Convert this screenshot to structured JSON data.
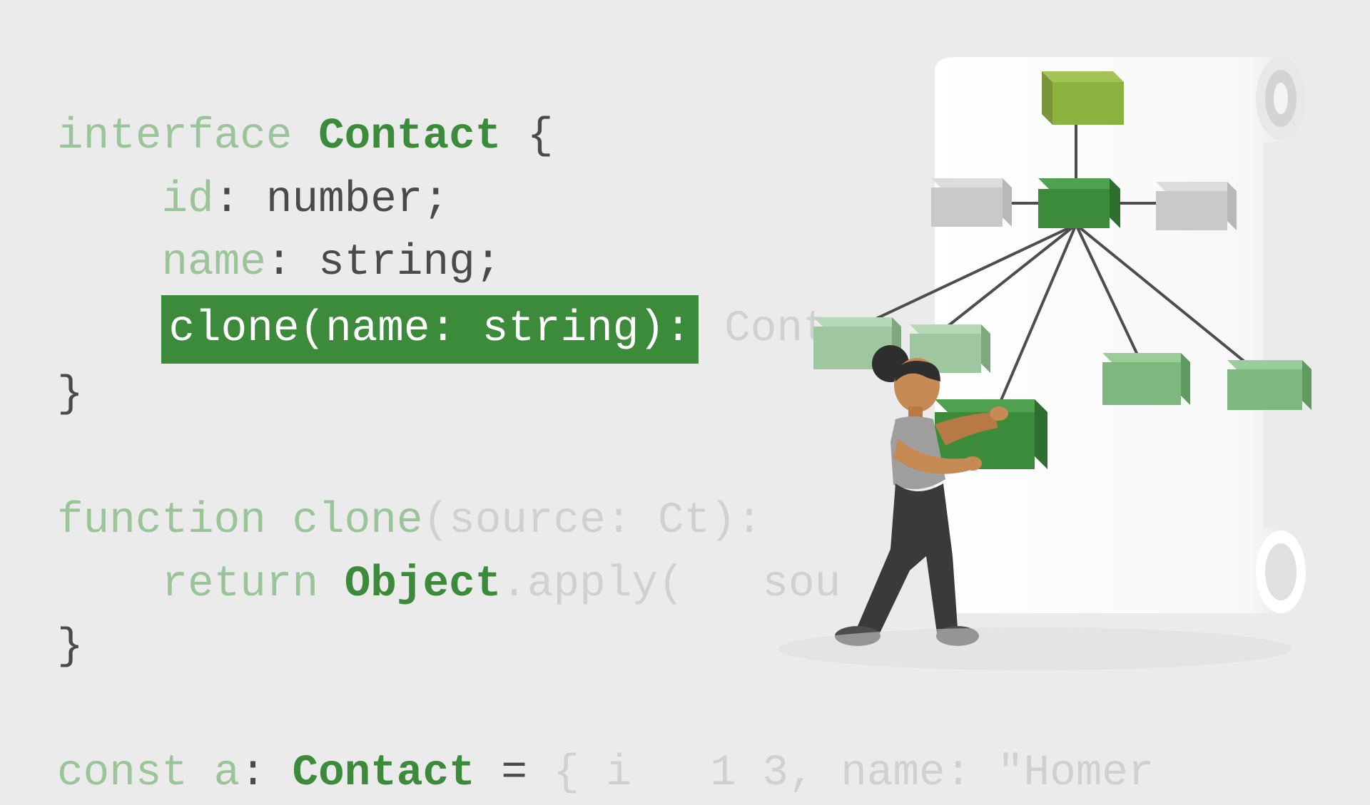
{
  "code": {
    "l1_kw": "interface",
    "l1_type": "Contact",
    "l1_brace": " {",
    "l2_kw": "id",
    "l2_rest": ": number;",
    "l3_kw": "name",
    "l3_rest": ": string;",
    "l4_hl": "clone(name: string):",
    "l4_ghost": " Cont",
    "l5_brace": "}",
    "l6_kw": "function",
    "l6_name": " clone",
    "l6_args_a": "(source: ",
    "l6_args_ghost": "C",
    "l6_args_b": "t):",
    "l6_brace": "{",
    "l7_kw": "return",
    "l7_type": "Object",
    "l7_rest": ".apply(",
    "l7_ghost": "sou",
    "l8_brace": "}",
    "l9_kw": "const",
    "l9_var": " a",
    "l9_colon": ": ",
    "l9_type": "Contact",
    "l9_eq": " = ",
    "l9_ghost": "{ i",
    "l9_num": "1",
    "l9_ghost2": "3, name: \"Homer"
  },
  "diagram": {
    "boxes": {
      "top": {
        "color": "#8bb33f"
      },
      "row2_left": {
        "color": "#c9c9c9"
      },
      "row2_center": {
        "color": "#3b8b3b"
      },
      "row2_right": {
        "color": "#c9c9c9"
      },
      "leaf1": {
        "color": "#9fc79f"
      },
      "leaf2": {
        "color": "#9fc79f"
      },
      "leaf3": {
        "color": "#3b8b3b"
      },
      "leaf4": {
        "color": "#7fb87f"
      },
      "leaf5": {
        "color": "#7fb87f"
      }
    }
  }
}
